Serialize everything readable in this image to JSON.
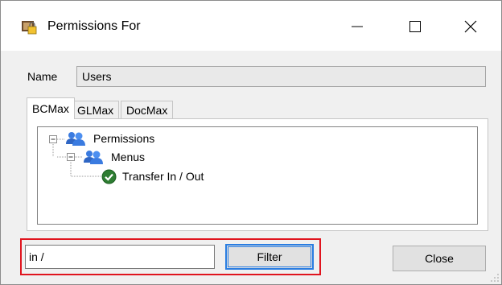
{
  "window": {
    "title": "Permissions For"
  },
  "name": {
    "label": "Name",
    "value": "Users"
  },
  "tabs": [
    {
      "label": "BCMax",
      "active": true
    },
    {
      "label": "GLMax",
      "active": false
    },
    {
      "label": "DocMax",
      "active": false
    }
  ],
  "tree": {
    "root": {
      "label": "Permissions",
      "icon": "group-icon",
      "expanded": true
    },
    "child": {
      "label": "Menus",
      "icon": "group-icon",
      "expanded": true
    },
    "leaf": {
      "label": "Transfer In / Out",
      "icon": "check-icon",
      "status": "granted"
    }
  },
  "filter": {
    "input_value": "in /",
    "button_label": "Filter"
  },
  "close_label": "Close",
  "colors": {
    "highlight": "#e0141e",
    "focus": "#2a7de1",
    "check": "#2e7d32"
  }
}
